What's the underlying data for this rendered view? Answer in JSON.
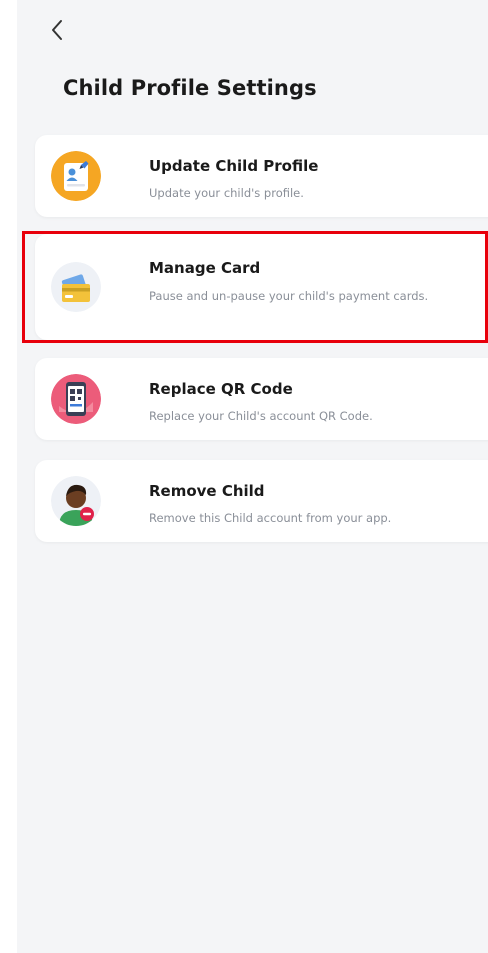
{
  "header": {
    "back_icon": "chevron-left-icon",
    "title": "Child Profile Settings"
  },
  "options": [
    {
      "title": "Update Child Profile",
      "description": "Update your child's profile.",
      "icon": "profile-card-icon"
    },
    {
      "title": "Manage Card",
      "description": "Pause and un-pause your child's payment cards.",
      "icon": "payment-cards-icon"
    },
    {
      "title": "Replace QR Code",
      "description": "Replace your Child's account QR Code.",
      "icon": "qr-code-phone-icon"
    },
    {
      "title": "Remove Child",
      "description": "Remove this Child account from your app.",
      "icon": "remove-child-icon"
    }
  ],
  "colors": {
    "background": "#f4f5f7",
    "card": "#ffffff",
    "title_text": "#1a1a1a",
    "description_text": "#8a8f98",
    "highlight": "#e8000b",
    "orange_icon": "#f5a623",
    "pink_icon": "#ec5c7a"
  }
}
